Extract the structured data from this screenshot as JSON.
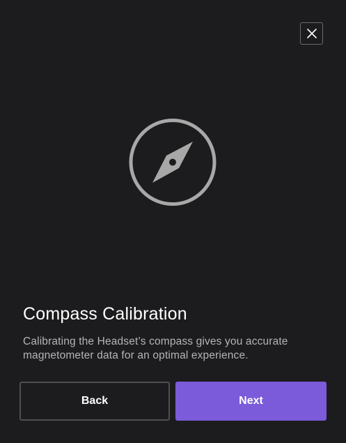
{
  "dialog": {
    "title": "Compass Calibration",
    "description": "Calibrating the Headset’s compass gives you accurate magnetometer data for an optimal experience.",
    "close_icon": "close-icon",
    "illustration_icon": "compass-icon"
  },
  "buttons": {
    "back_label": "Back",
    "next_label": "Next"
  },
  "colors": {
    "background": "#1c1c1e",
    "primary_accent": "#7b5bd9",
    "icon_gray": "#a8a8a8",
    "title_text": "#ffffff",
    "body_text": "#b4b4ba"
  }
}
